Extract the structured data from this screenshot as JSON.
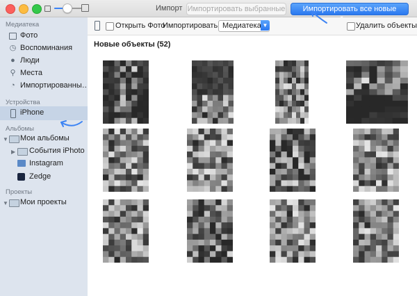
{
  "window": {
    "title": "Импорт"
  },
  "toolbar": {
    "import_selected_label": "Импортировать выбранные",
    "import_all_label": "Импортировать все новые объекты",
    "zoom_level": 0.45
  },
  "sidebar": {
    "sections": [
      {
        "label": "Медиатека",
        "items": [
          {
            "label": "Фото",
            "icon": "photos-icon"
          },
          {
            "label": "Воспоминания",
            "icon": "memories-icon"
          },
          {
            "label": "Люди",
            "icon": "people-icon"
          },
          {
            "label": "Места",
            "icon": "places-icon"
          },
          {
            "label": "Импортированны…",
            "icon": "imports-icon"
          }
        ]
      },
      {
        "label": "Устройства",
        "items": [
          {
            "label": "iPhone",
            "icon": "iphone-icon",
            "selected": true
          }
        ]
      },
      {
        "label": "Альбомы",
        "items": [
          {
            "label": "Мои альбомы",
            "icon": "folder-icon"
          },
          {
            "label": "События iPhoto",
            "icon": "folder-icon"
          },
          {
            "label": "Instagram",
            "icon": "instagram-icon"
          },
          {
            "label": "Zedge",
            "icon": "zedge-icon"
          }
        ]
      },
      {
        "label": "Проекты",
        "items": [
          {
            "label": "Мои проекты",
            "icon": "folder-icon"
          }
        ]
      }
    ]
  },
  "content": {
    "open_photos_label": "Открыть Фото",
    "import_to_label": "Импортировать в:",
    "import_to_value": "Медиатека",
    "delete_items_label": "Удалить объекты",
    "section_heading": "Новые объекты (52)"
  },
  "colors": {
    "accent": "#2a78f0",
    "sidebar_bg": "#dde4ee",
    "selection": "#c6d4e6",
    "annotation_arrow": "#3d84f4"
  }
}
